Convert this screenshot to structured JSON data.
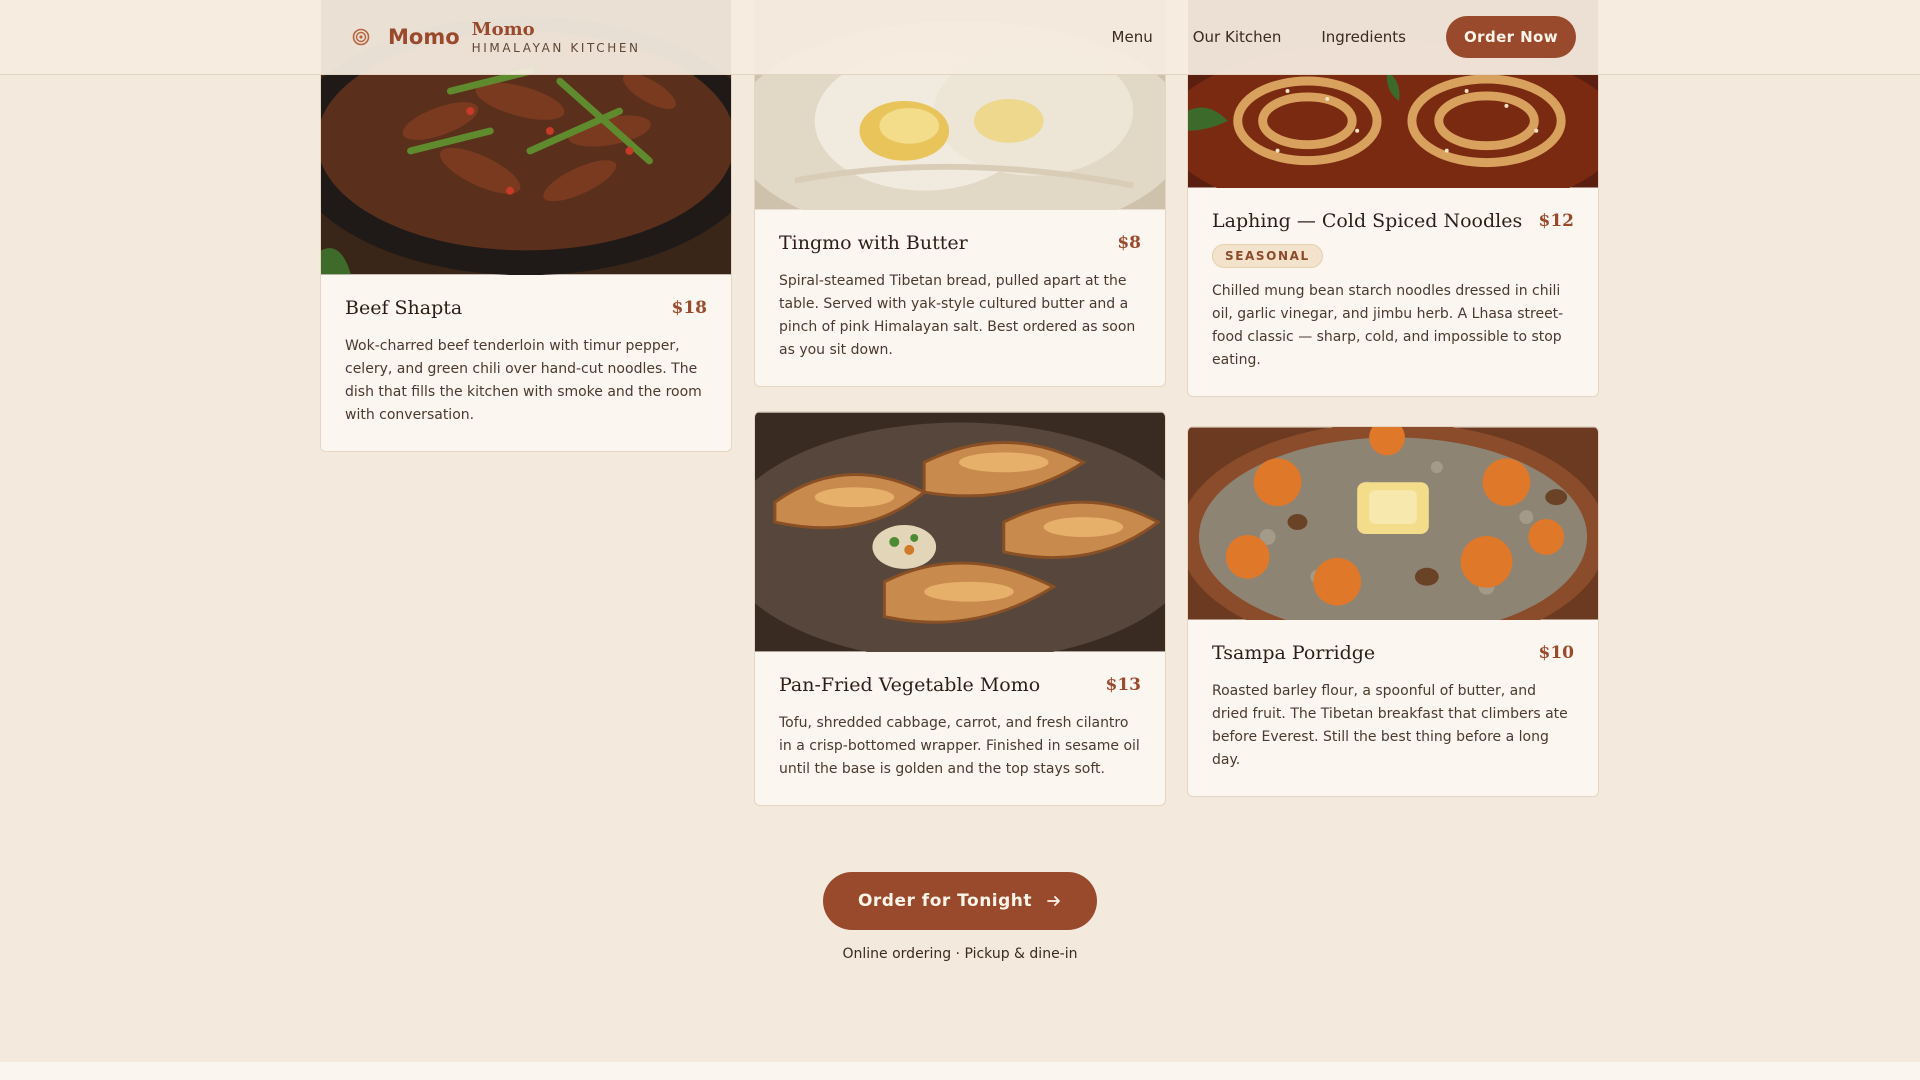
{
  "header": {
    "brand_name": "Momo",
    "brand_title": "Momo",
    "brand_subtitle": "HIMALAYAN KITCHEN",
    "nav": [
      "Menu",
      "Our Kitchen",
      "Ingredients"
    ],
    "order_label": "Order Now"
  },
  "menu": {
    "items": [
      {
        "title": "Beef Shapta",
        "price": "$18",
        "description": "Wok-charred beef tenderloin with timur pepper, celery, and green chili over hand-cut noodles. The dish that fills the kitchen with smoke and the room with conversation."
      },
      {
        "title": "Tingmo with Butter",
        "price": "$8",
        "description": "Spiral-steamed Tibetan bread, pulled apart at the table. Served with yak-style cultured butter and a pinch of pink Himalayan salt. Best ordered as soon as you sit down."
      },
      {
        "title": "Laphing — Cold Spiced Noodles",
        "price": "$12",
        "badge": "SEASONAL",
        "description": "Chilled mung bean starch noodles dressed in chili oil, garlic vinegar, and jimbu herb. A Lhasa street-food classic — sharp, cold, and impossible to stop eating."
      },
      {
        "title": "Pan-Fried Vegetable Momo",
        "price": "$13",
        "description": "Tofu, shredded cabbage, carrot, and fresh cilantro in a crisp-bottomed wrapper. Finished in sesame oil until the base is golden and the top stays soft."
      },
      {
        "title": "Tsampa Porridge",
        "price": "$10",
        "description": "Roasted barley flour, a spoonful of butter, and dried fruit. The Tibetan breakfast that climbers ate before Everest. Still the best thing before a long day."
      }
    ]
  },
  "cta": {
    "label": "Order for Tonight",
    "note": "Online ordering · Pickup & dine-in"
  },
  "colors": {
    "accent": "#9a4a2c",
    "background": "#f4e9dd",
    "card": "#fbf6f0"
  }
}
